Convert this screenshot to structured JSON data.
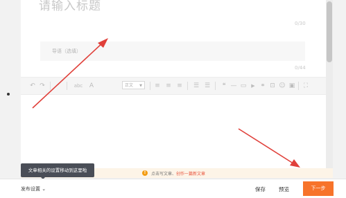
{
  "editor": {
    "title_placeholder": "请输入标题",
    "title_counter": "0/30",
    "summary_placeholder": "导语（选填）",
    "summary_counter": "0/44"
  },
  "toolbar": {
    "undo_glyph": "↶",
    "redo_glyph": "↷",
    "format_brush_glyph": "ᐟ",
    "strike_label": "abc",
    "font_size_label": "A",
    "font_select_value": "正文",
    "align_left_glyph": "≡",
    "align_center_glyph": "≡",
    "align_right_glyph": "≡",
    "ordered_list_glyph": "☰",
    "unordered_list_glyph": "☰",
    "quote_glyph": "❝",
    "divider_glyph": "—",
    "image_glyph": "▭",
    "video_glyph": "▶",
    "link_glyph": "⚭",
    "attachment_glyph": "⊡",
    "emoji_glyph": "☺",
    "code_glyph": "▣",
    "fullscreen_glyph": "⛶"
  },
  "tip": {
    "text": "点击写文章、",
    "link": "创作一篇新文章"
  },
  "tooltip": {
    "text": "文章相关的设置移动到这里啦"
  },
  "footer": {
    "publish_settings_label": "发布设置",
    "save_label": "保存",
    "preview_label": "预览",
    "next_label": "下一步"
  },
  "colors": {
    "accent": "#f7732a",
    "annotation_arrow": "#e0403a",
    "tooltip_bg": "#4a4e57",
    "tip_bg": "#fdf4e7"
  }
}
